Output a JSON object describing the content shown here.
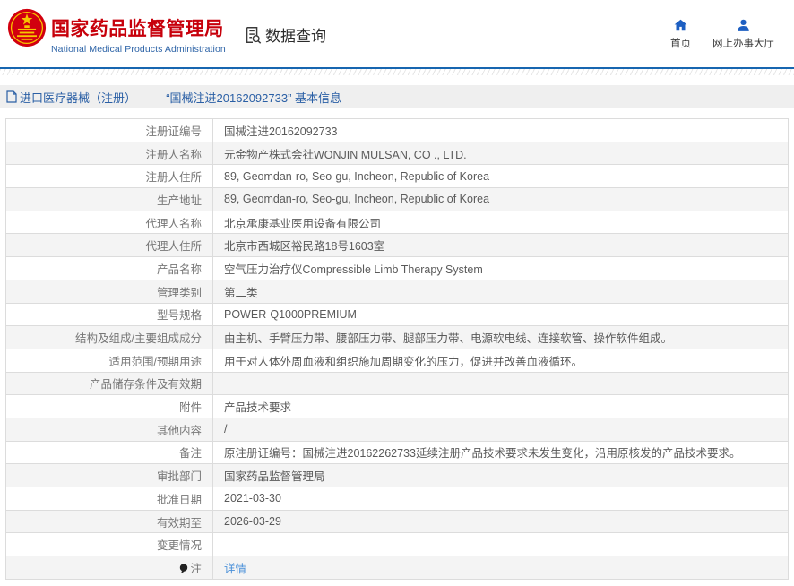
{
  "header": {
    "title": "国家药品监督管理局",
    "subtitle": "National Medical Products Administration",
    "data_query": "数据查询",
    "nav": [
      {
        "label": "首页",
        "icon": "home-icon"
      },
      {
        "label": "网上办事大厅",
        "icon": "person-icon"
      }
    ]
  },
  "colors": {
    "brand_red": "#c7000b",
    "brand_blue": "#2e64a7",
    "line_blue": "#1766b0",
    "link_blue": "#4a90d9",
    "alt_row_gray": "#f4f4f4"
  },
  "breadcrumb": {
    "text": "进口医疗器械（注册） —— “国械注进20162092733” 基本信息"
  },
  "table": {
    "rows": [
      {
        "label": "注册证编号",
        "value": "国械注进20162092733"
      },
      {
        "label": "注册人名称",
        "value": "元金物产株式会社WONJIN MULSAN, CO ., LTD."
      },
      {
        "label": "注册人住所",
        "value": "89, Geomdan-ro, Seo-gu, Incheon, Republic of Korea"
      },
      {
        "label": "生产地址",
        "value": "89, Geomdan-ro, Seo-gu, Incheon, Republic of Korea"
      },
      {
        "label": "代理人名称",
        "value": "北京承康基业医用设备有限公司"
      },
      {
        "label": "代理人住所",
        "value": "北京市西城区裕民路18号1603室"
      },
      {
        "label": "产品名称",
        "value": "空气压力治疗仪Compressible Limb Therapy System"
      },
      {
        "label": "管理类别",
        "value": "第二类"
      },
      {
        "label": "型号规格",
        "value": "POWER-Q1000PREMIUM"
      },
      {
        "label": "结构及组成/主要组成成分",
        "value": "由主机、手臂压力带、腰部压力带、腿部压力带、电源软电线、连接软管、操作软件组成。"
      },
      {
        "label": "适用范围/预期用途",
        "value": "用于对人体外周血液和组织施加周期变化的压力，促进并改善血液循环。"
      },
      {
        "label": "产品储存条件及有效期",
        "value": ""
      },
      {
        "label": "附件",
        "value": "产品技术要求"
      },
      {
        "label": "其他内容",
        "value": "/"
      },
      {
        "label": "备注",
        "value": "原注册证编号：国械注进20162262733延续注册产品技术要求未发生变化，沿用原核发的产品技术要求。"
      },
      {
        "label": "审批部门",
        "value": "国家药品监督管理局"
      },
      {
        "label": "批准日期",
        "value": "2021-03-30"
      },
      {
        "label": "有效期至",
        "value": "2026-03-29"
      },
      {
        "label": "变更情况",
        "value": ""
      },
      {
        "label": "注",
        "value": "详情",
        "link": true,
        "pin": true
      }
    ]
  }
}
